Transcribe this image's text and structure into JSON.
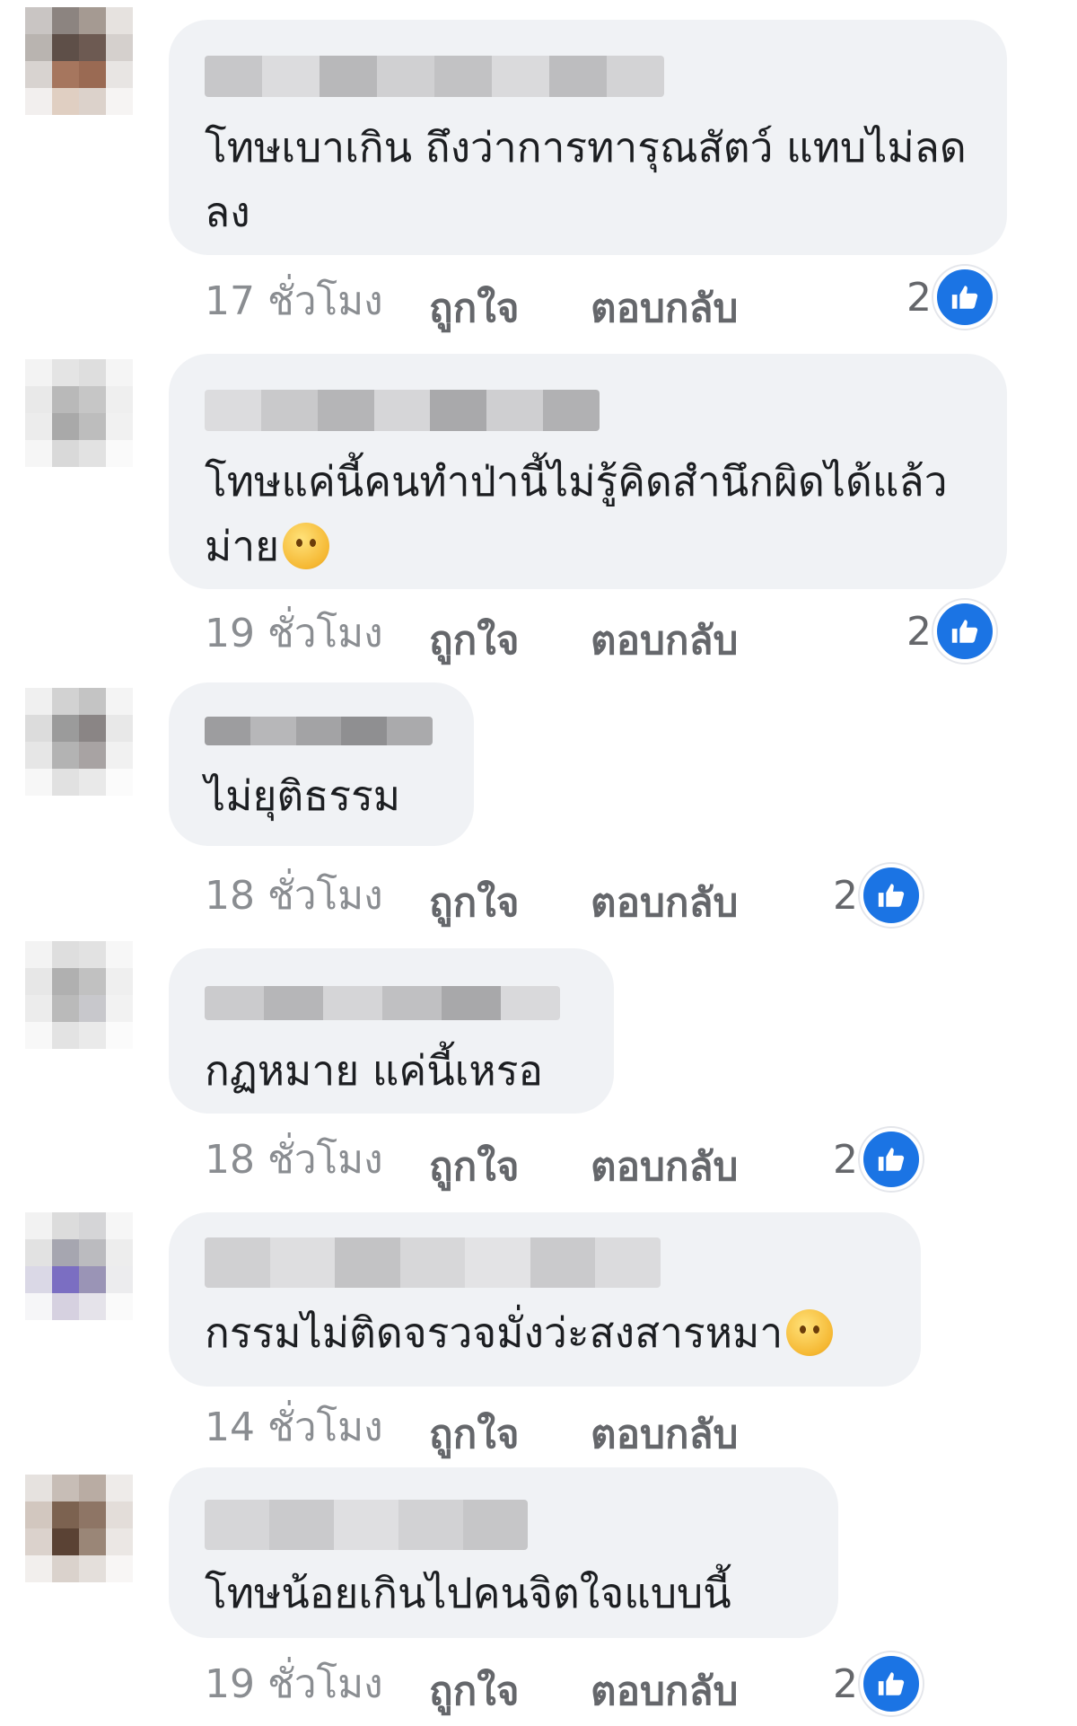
{
  "comments": [
    {
      "text": "โทษเบาเกิน ถึงว่าการทารุณสัตว์ แทบไม่ลดลง",
      "emoji": "",
      "time": "17 ชั่วโมง",
      "like_label": "ถูกใจ",
      "reply_label": "ตอบกลับ",
      "reaction_count": "2"
    },
    {
      "text": "โทษแค่นี้คนทำป่านี้ไม่รู้คิดสำนึกผิดได้แล้วม่าย",
      "emoji": "grinning-face-emoji",
      "time": "19 ชั่วโมง",
      "like_label": "ถูกใจ",
      "reply_label": "ตอบกลับ",
      "reaction_count": "2"
    },
    {
      "text": "ไม่ยุติธรรม",
      "emoji": "",
      "time": "18 ชั่วโมง",
      "like_label": "ถูกใจ",
      "reply_label": "ตอบกลับ",
      "reaction_count": "2"
    },
    {
      "text": "กฏหมาย แค่นี้เหรอ",
      "emoji": "",
      "time": "18 ชั่วโมง",
      "like_label": "ถูกใจ",
      "reply_label": "ตอบกลับ",
      "reaction_count": "2"
    },
    {
      "text": "กรรมไม่ติดจรวจมั่งว่ะสงสารหมา",
      "emoji": "sad-face-emoji",
      "time": "14 ชั่วโมง",
      "like_label": "ถูกใจ",
      "reply_label": "ตอบกลับ",
      "reaction_count": ""
    },
    {
      "text": "โทษน้อยเกินไปคนจิตใจแบบนี้",
      "emoji": "",
      "time": "19 ชั่วโมง",
      "like_label": "ถูกใจ",
      "reply_label": "ตอบกลับ",
      "reaction_count": "2"
    }
  ],
  "colors": {
    "bubble_bg": "#f0f2f5",
    "meta_text": "#65676b",
    "like_blue": "#1b74e4"
  },
  "icons": {
    "reaction": "like-thumbs-up-icon"
  }
}
